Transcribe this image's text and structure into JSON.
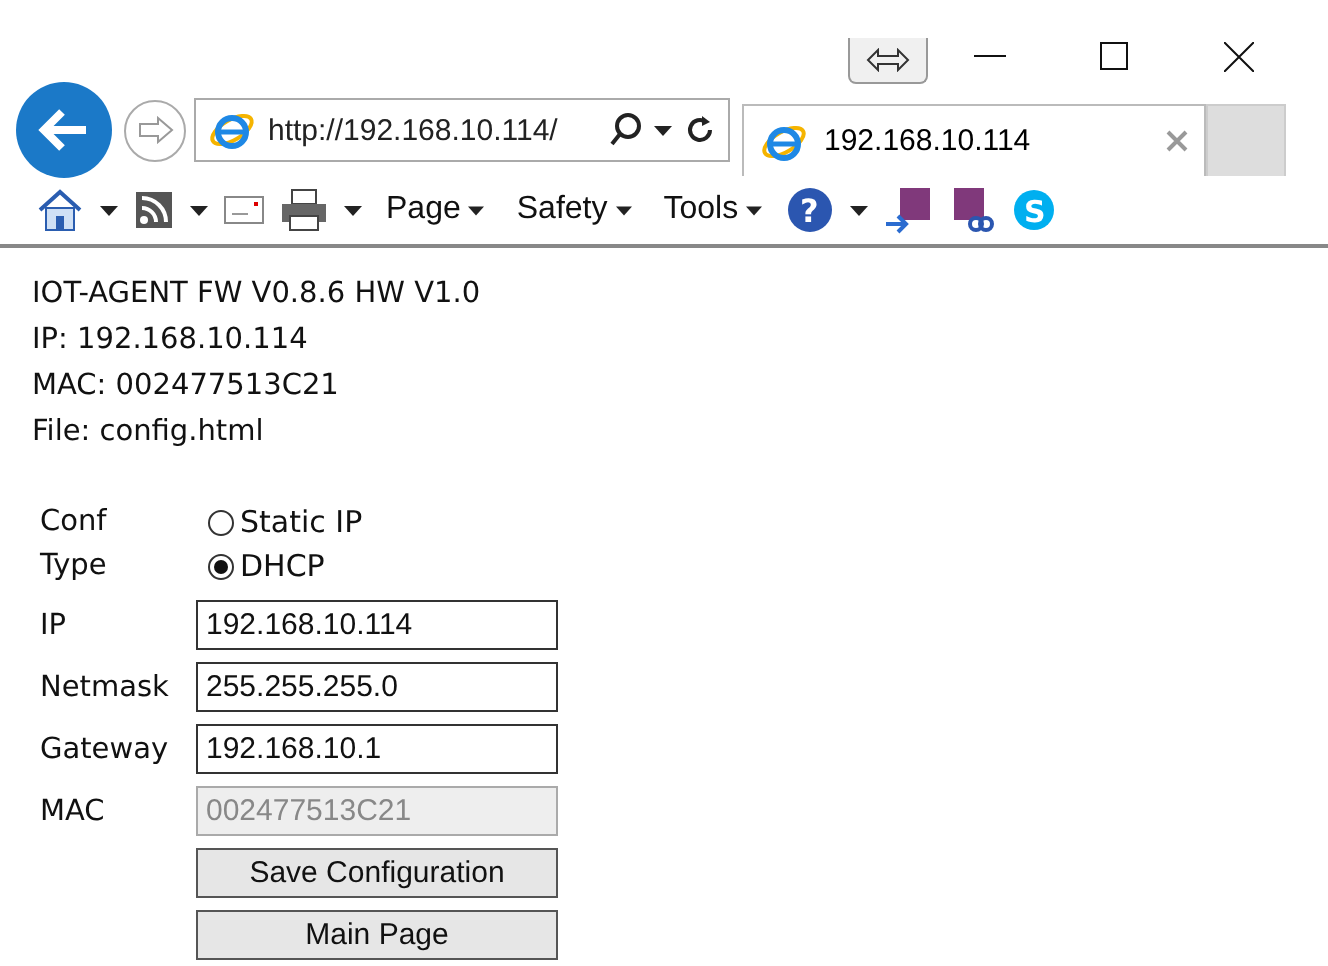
{
  "window_controls": {
    "restore_tab": true
  },
  "navigation": {
    "address": "http://192.168.10.114/",
    "tabs": [
      {
        "title": "192.168.10.114",
        "selected": true
      }
    ]
  },
  "command_bar": [
    {
      "kind": "home"
    },
    {
      "kind": "feeds"
    },
    {
      "kind": "mail"
    },
    {
      "kind": "print"
    },
    {
      "kind": "menu",
      "label": "Page"
    },
    {
      "kind": "menu",
      "label": "Safety"
    },
    {
      "kind": "menu",
      "label": "Tools"
    },
    {
      "kind": "help",
      "glyph": "?"
    },
    {
      "kind": "note-send"
    },
    {
      "kind": "note-link"
    },
    {
      "kind": "skype",
      "glyph": "S"
    }
  ],
  "info": [
    "IOT-AGENT FW V0.8.6 HW V1.0",
    "IP: 192.168.10.114",
    "MAC: 002477513C21",
    "File: config.html"
  ],
  "form": {
    "conf_type": {
      "label": "Conf Type",
      "options": [
        {
          "label": "Static IP",
          "selected": false
        },
        {
          "label": "DHCP",
          "selected": true
        }
      ]
    },
    "fields": [
      {
        "label": "IP",
        "value": "192.168.10.114",
        "disabled": false
      },
      {
        "label": "Netmask",
        "value": "255.255.255.0",
        "disabled": false
      },
      {
        "label": "Gateway",
        "value": "192.168.10.1",
        "disabled": false
      },
      {
        "label": "MAC",
        "value": "002477513C21",
        "disabled": true
      }
    ],
    "buttons": [
      "Save Configuration",
      "Main Page"
    ]
  }
}
